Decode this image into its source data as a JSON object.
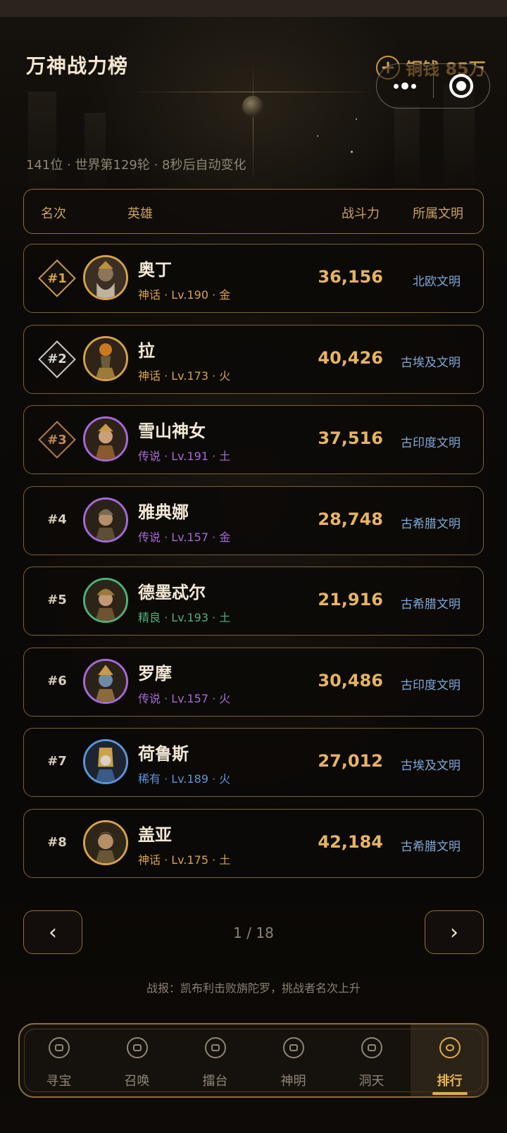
{
  "header": {
    "title": "万神战力榜",
    "currency_label": "铜钱 85万",
    "subtitle": "141位 · 世界第129轮 · 8秒后自动变化"
  },
  "table_header": {
    "rank": "名次",
    "hero": "英雄",
    "power": "战斗力",
    "civ": "所属文明"
  },
  "rows": [
    {
      "rank": "#1",
      "name": "奥丁",
      "meta": "神话 · Lv.190 · 金",
      "power": "36,156",
      "civ": "北欧文明",
      "rarity_color": "#d4a24c"
    },
    {
      "rank": "#2",
      "name": "拉",
      "meta": "神话 · Lv.173 · 火",
      "power": "40,426",
      "civ": "古埃及文明",
      "rarity_color": "#d4a24c"
    },
    {
      "rank": "#3",
      "name": "雪山神女",
      "meta": "传说 · Lv.191 · 土",
      "power": "37,516",
      "civ": "古印度文明",
      "rarity_color": "#a66ad6"
    },
    {
      "rank": "#4",
      "name": "雅典娜",
      "meta": "传说 · Lv.157 · 金",
      "power": "28,748",
      "civ": "古希腊文明",
      "rarity_color": "#a66ad6"
    },
    {
      "rank": "#5",
      "name": "德墨忒尔",
      "meta": "精良 · Lv.193 · 土",
      "power": "21,916",
      "civ": "古希腊文明",
      "rarity_color": "#4fb07a"
    },
    {
      "rank": "#6",
      "name": "罗摩",
      "meta": "传说 · Lv.157 · 火",
      "power": "30,486",
      "civ": "古印度文明",
      "rarity_color": "#a66ad6"
    },
    {
      "rank": "#7",
      "name": "荷鲁斯",
      "meta": "稀有 · Lv.189 · 火",
      "power": "27,012",
      "civ": "古埃及文明",
      "rarity_color": "#5b95d8"
    },
    {
      "rank": "#8",
      "name": "盖亚",
      "meta": "神话 · Lv.175 · 土",
      "power": "42,184",
      "civ": "古希腊文明",
      "rarity_color": "#d4a24c"
    }
  ],
  "pagination": {
    "prev": "‹",
    "next": "›",
    "page": "1 / 18"
  },
  "news": "战报：凯布利击败旃陀罗，挑战者名次上升",
  "tabs": [
    {
      "label": "寻宝",
      "icon": "treasure-icon"
    },
    {
      "label": "召唤",
      "icon": "summon-icon"
    },
    {
      "label": "擂台",
      "icon": "arena-icon"
    },
    {
      "label": "神明",
      "icon": "gods-icon"
    },
    {
      "label": "洞天",
      "icon": "cave-icon"
    },
    {
      "label": "排行",
      "icon": "ranking-icon",
      "active": true
    }
  ],
  "colors": {
    "gold": "#e5b463",
    "civilization_blue": "#7ea8d8",
    "mythic": "#d4a24c",
    "legendary": "#a66ad6",
    "epic": "#4fb07a",
    "rare": "#5b95d8"
  }
}
